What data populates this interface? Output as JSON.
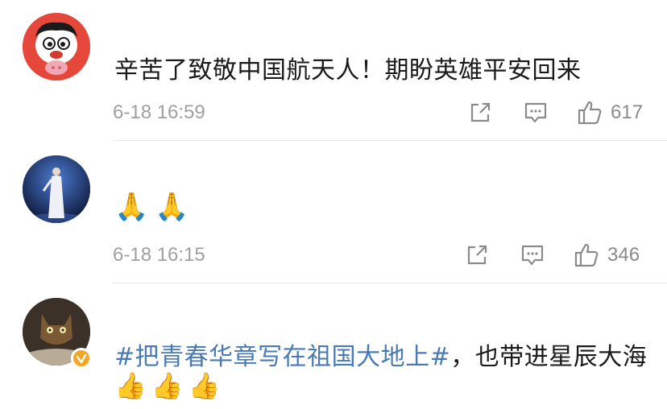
{
  "comments": [
    {
      "text": "辛苦了致敬中国航天人！期盼英雄平安回来",
      "time": "6-18 16:59",
      "likes": "617",
      "icons": [
        "share-icon",
        "comment-icon",
        "like-icon"
      ]
    },
    {
      "emojis": [
        "🙏",
        "🙏"
      ],
      "time": "6-18 16:15",
      "likes": "346",
      "icons": [
        "share-icon",
        "comment-icon",
        "like-icon"
      ]
    },
    {
      "hashtag": "#把青春华章写在祖国大地上#",
      "text": "，也带进星辰大海",
      "emojis": [
        "👍",
        "👍",
        "👍"
      ],
      "verified": true
    }
  ],
  "colors": {
    "hashtag": "#4a7ab5",
    "meta": "#a0a0a0",
    "divider": "#e8e8e8",
    "verified_badge": "#f5a623"
  }
}
